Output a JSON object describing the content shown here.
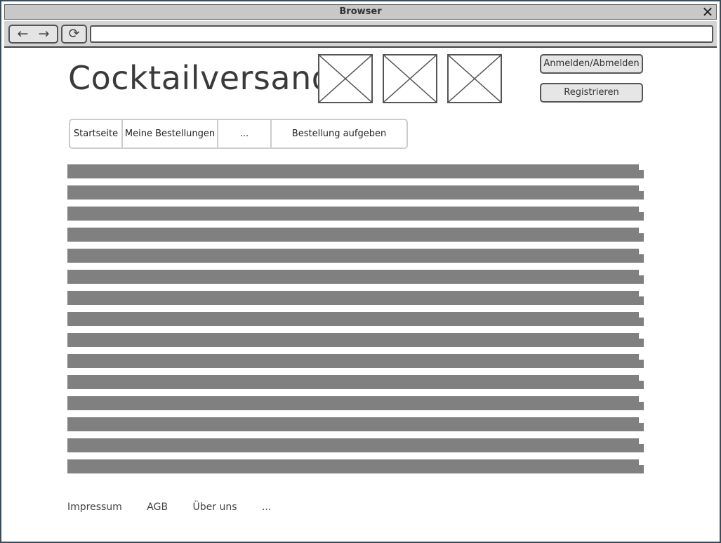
{
  "window": {
    "title": "Browser"
  },
  "toolbar": {
    "back_glyph": "←",
    "forward_glyph": "→",
    "reload_glyph": "⟳",
    "address_value": ""
  },
  "header": {
    "logo_text": "Cocktailversand",
    "login_button": "Anmelden/Abmelden",
    "register_button": "Registrieren",
    "image_placeholders": [
      "image-placeholder",
      "image-placeholder",
      "image-placeholder"
    ]
  },
  "nav": {
    "tabs": [
      {
        "label": "Startseite"
      },
      {
        "label": "Meine Bestellungen"
      },
      {
        "label": "..."
      },
      {
        "label": "Bestellung aufgeben"
      }
    ]
  },
  "content": {
    "placeholder_line_count": 15,
    "bar_color": "#808080"
  },
  "footer": {
    "links": [
      {
        "label": "Impressum"
      },
      {
        "label": "AGB"
      },
      {
        "label": "Über uns"
      },
      {
        "label": "..."
      }
    ]
  }
}
